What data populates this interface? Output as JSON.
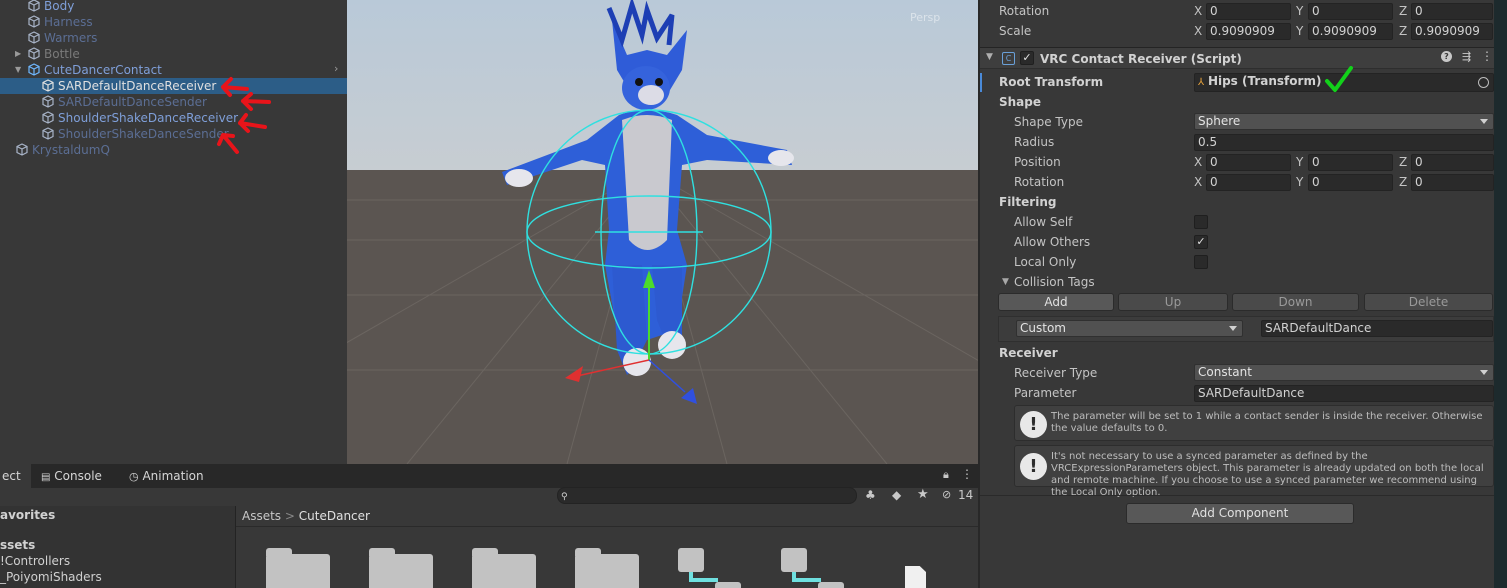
{
  "hierarchy": {
    "items": [
      {
        "label": "Body",
        "style": "blue",
        "indent": 0,
        "fold": "",
        "icon": "cube-icon"
      },
      {
        "label": "Harness",
        "style": "dimblue",
        "indent": 0,
        "fold": "",
        "icon": "cube-icon"
      },
      {
        "label": "Warmers",
        "style": "dimblue",
        "indent": 0,
        "fold": "",
        "icon": "cube-icon"
      },
      {
        "label": "Bottle",
        "style": "dim",
        "indent": 0,
        "fold": "▶",
        "icon": "cube-icon"
      },
      {
        "label": "CuteDancerContact",
        "style": "blue",
        "indent": 0,
        "fold": "▼",
        "icon": "prefab-cube-icon"
      },
      {
        "label": "SARDefaultDanceReceiver",
        "style": "white",
        "indent": 1,
        "fold": "",
        "icon": "cube-icon",
        "selected": true
      },
      {
        "label": "SARDefaultDanceSender",
        "style": "dimblue",
        "indent": 1,
        "fold": "",
        "icon": "cube-icon"
      },
      {
        "label": "ShoulderShakeDanceReceiver",
        "style": "blue",
        "indent": 1,
        "fold": "",
        "icon": "cube-icon"
      },
      {
        "label": "ShoulderShakeDanceSender",
        "style": "dimblue",
        "indent": 1,
        "fold": "",
        "icon": "cube-icon"
      },
      {
        "label": "KrystaldumQ",
        "style": "dimblue",
        "indent": -1,
        "fold": "▶",
        "icon": "cube-icon"
      }
    ]
  },
  "scene": {
    "persp_label": "Persp"
  },
  "inspector": {
    "transform": {
      "rotation_label": "Rotation",
      "rotation": {
        "x": "0",
        "y": "0",
        "z": "0"
      },
      "scale_label": "Scale",
      "scale": {
        "x": "0.9090909",
        "y": "0.9090909",
        "z": "0.9090909"
      }
    },
    "component": {
      "title": "VRC Contact Receiver (Script)",
      "root_transform_label": "Root Transform",
      "root_transform_value": "Hips (Transform)",
      "shape_header": "Shape",
      "shape_type_label": "Shape Type",
      "shape_type_value": "Sphere",
      "radius_label": "Radius",
      "radius_value": "0.5",
      "position_label": "Position",
      "position": {
        "x": "0",
        "y": "0",
        "z": "0"
      },
      "rotation_label": "Rotation",
      "rotation": {
        "x": "0",
        "y": "0",
        "z": "0"
      },
      "filtering_header": "Filtering",
      "allow_self_label": "Allow Self",
      "allow_self": false,
      "allow_others_label": "Allow Others",
      "allow_others": true,
      "local_only_label": "Local Only",
      "local_only": false,
      "collision_tags_label": "Collision Tags",
      "buttons": {
        "add": "Add",
        "up": "Up",
        "down": "Down",
        "delete": "Delete"
      },
      "tag_mode": "Custom",
      "tag_value": "SARDefaultDance",
      "receiver_header": "Receiver",
      "receiver_type_label": "Receiver Type",
      "receiver_type_value": "Constant",
      "parameter_label": "Parameter",
      "parameter_value": "SARDefaultDance",
      "help1": "The parameter will be set to 1 while a contact sender is inside the receiver.  Otherwise the value defaults to 0.",
      "help2": "It's not necessary to use a synced parameter as defined by the VRCExpressionParameters object.  This parameter is already updated on both the local and remote machine.  If you choose to use a synced parameter we recommend using the Local Only option."
    },
    "add_component_label": "Add Component",
    "axis": {
      "x": "X",
      "y": "Y",
      "z": "Z"
    }
  },
  "bottom": {
    "tabs": {
      "project": "ect",
      "console": "Console",
      "animation": "Animation"
    },
    "hidden_count": "14",
    "sidebar": {
      "favorites": "avorites",
      "assets": "ssets",
      "item1": "!Controllers",
      "item2": "_PoiyomiShaders"
    },
    "breadcrumb": {
      "root": "Assets",
      "sep": ">",
      "current": "CuteDancer"
    }
  },
  "colors": {
    "annotation_red": "#e8141a",
    "annotation_green": "#12d11a",
    "selection": "#2c5d87",
    "gizmo_cyan": "#2fe0e0"
  }
}
